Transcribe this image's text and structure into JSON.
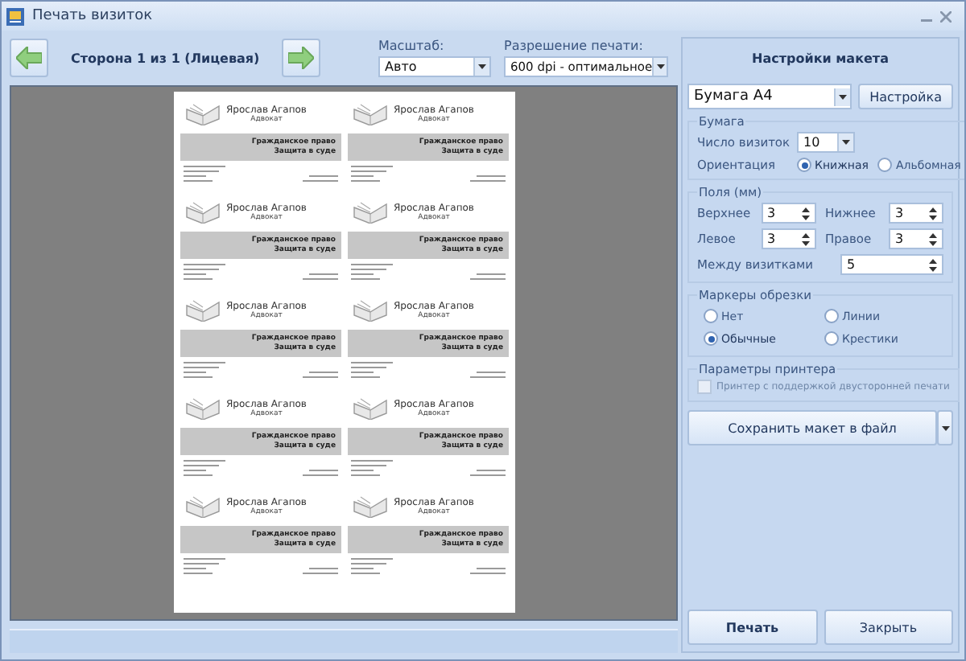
{
  "window": {
    "title": "Печать визиток"
  },
  "toolbar": {
    "page_label": "Сторона 1 из 1 (Лицевая)",
    "scale": {
      "label": "Масштаб:",
      "value": "Авто"
    },
    "resolution": {
      "label": "Разрешение печати:",
      "value": "600 dpi - оптимальное"
    }
  },
  "preview": {
    "cards": [
      {
        "name": "Ярослав Агапов",
        "position": "Адвокат",
        "specialty": [
          "Гражданское право",
          "Защита в суде"
        ]
      },
      {
        "name": "Ярослав Агапов",
        "position": "Адвокат",
        "specialty": [
          "Гражданское право",
          "Защита в суде"
        ]
      },
      {
        "name": "Ярослав Агапов",
        "position": "Адвокат",
        "specialty": [
          "Гражданское право",
          "Защита в суде"
        ]
      },
      {
        "name": "Ярослав Агапов",
        "position": "Адвокат",
        "specialty": [
          "Гражданское право",
          "Защита в суде"
        ]
      },
      {
        "name": "Ярослав Агапов",
        "position": "Адвокат",
        "specialty": [
          "Гражданское право",
          "Защита в суде"
        ]
      },
      {
        "name": "Ярослав Агапов",
        "position": "Адвокат",
        "specialty": [
          "Гражданское право",
          "Защита в суде"
        ]
      },
      {
        "name": "Ярослав Агапов",
        "position": "Адвокат",
        "specialty": [
          "Гражданское право",
          "Защита в суде"
        ]
      },
      {
        "name": "Ярослав Агапов",
        "position": "Адвокат",
        "specialty": [
          "Гражданское право",
          "Защита в суде"
        ]
      },
      {
        "name": "Ярослав Агапов",
        "position": "Адвокат",
        "specialty": [
          "Гражданское право",
          "Защита в суде"
        ]
      },
      {
        "name": "Ярослав Агапов",
        "position": "Адвокат",
        "specialty": [
          "Гражданское право",
          "Защита в суде"
        ]
      }
    ]
  },
  "panel": {
    "title": "Настройки макета",
    "paper": {
      "value": "Бумага А4",
      "button": "Настройка"
    },
    "paper_group": {
      "legend": "Бумага",
      "count_label": "Число визиток",
      "count": "10",
      "orientation_label": "Ориентация",
      "orientations": [
        {
          "label": "Книжная",
          "selected": true
        },
        {
          "label": "Альбомная",
          "selected": false
        }
      ]
    },
    "margins": {
      "legend": "Поля (мм)",
      "fields": [
        {
          "label": "Верхнее",
          "value": "3"
        },
        {
          "label": "Нижнее",
          "value": "3"
        },
        {
          "label": "Левое",
          "value": "3"
        },
        {
          "label": "Правое",
          "value": "3"
        }
      ],
      "gap": {
        "label": "Между визитками",
        "value": "5"
      }
    },
    "cut_marks": {
      "legend": "Маркеры обрезки",
      "options": [
        {
          "label": "Нет",
          "selected": false
        },
        {
          "label": "Линии",
          "selected": false
        },
        {
          "label": "Обычные",
          "selected": true
        },
        {
          "label": "Крестики",
          "selected": false
        }
      ]
    },
    "printer": {
      "legend": "Параметры принтера",
      "duplex": {
        "label": "Принтер с поддержкой двусторонней печати",
        "checked": false,
        "disabled": true
      }
    },
    "save_button": "Сохранить макет в файл",
    "print_button": "Печать",
    "close_button": "Закрыть"
  }
}
